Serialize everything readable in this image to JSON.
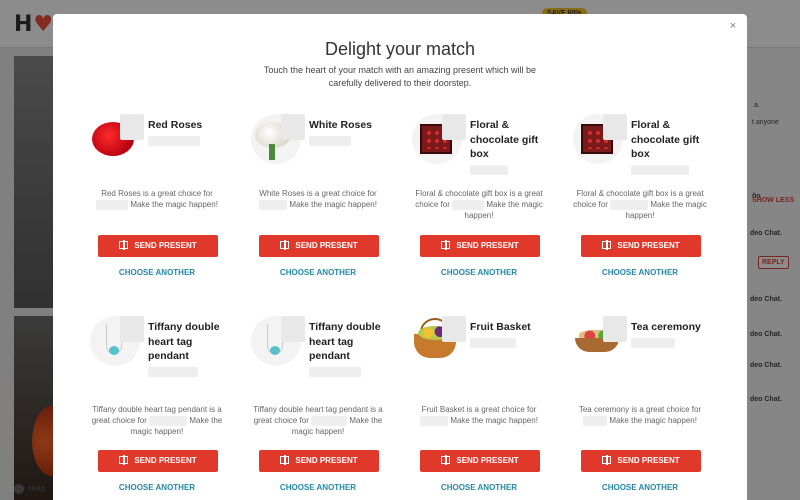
{
  "background": {
    "logo": "H",
    "save_badge": "SAVE 60%",
    "right_lines": [
      "a.",
      "t anyone",
      "ño",
      "deo Chat.",
      "deo Chat.",
      "deo Chat.",
      "deo Chat.",
      "deo Chat."
    ],
    "show_less": "SHOW LESS",
    "reply": "REPLY",
    "help": "Help"
  },
  "modal": {
    "close": "×",
    "title": "Delight your match",
    "subtitle": "Touch the heart of your match with an amazing present which will be carefully delivered to their doorstep."
  },
  "gifts": [
    {
      "name": "Red Roses",
      "desc_pre": "Red Roses is a great choice for",
      "desc_post": "Make the magic happen!",
      "send": "SEND PRESENT",
      "choose": "CHOOSE ANOTHER"
    },
    {
      "name": "White Roses",
      "desc_pre": "White Roses is a great choice for",
      "desc_post": "Make the magic happen!",
      "send": "SEND PRESENT",
      "choose": "CHOOSE ANOTHER"
    },
    {
      "name": "Floral & chocolate gift box",
      "desc_pre": "Floral & chocolate gift box is a great choice for",
      "desc_post": "Make the magic happen!",
      "send": "SEND PRESENT",
      "choose": "CHOOSE ANOTHER"
    },
    {
      "name": "Floral & chocolate gift box",
      "desc_pre": "Floral & chocolate gift box is a great choice for",
      "desc_post": "Make the magic happen!",
      "send": "SEND PRESENT",
      "choose": "CHOOSE ANOTHER"
    },
    {
      "name": "Tiffany double heart tag pendant",
      "desc_pre": "Tiffany double heart tag pendant is a great choice for",
      "desc_post": "Make the magic happen!",
      "send": "SEND PRESENT",
      "choose": "CHOOSE ANOTHER"
    },
    {
      "name": "Tiffany double heart tag pendant",
      "desc_pre": "Tiffany double heart tag pendant is a great choice for",
      "desc_post": "Make the magic happen!",
      "send": "SEND PRESENT",
      "choose": "CHOOSE ANOTHER"
    },
    {
      "name": "Fruit Basket",
      "desc_pre": "Fruit Basket is a great choice for",
      "desc_post": "Make the magic happen!",
      "send": "SEND PRESENT",
      "choose": "CHOOSE ANOTHER"
    },
    {
      "name": "Tea ceremony",
      "desc_pre": "Tea ceremony is a great choice for",
      "desc_post": "Make the magic happen!",
      "send": "SEND PRESENT",
      "choose": "CHOOSE ANOTHER"
    }
  ],
  "colors": {
    "send_button": "#e0392b",
    "choose_link": "#2588a5"
  }
}
